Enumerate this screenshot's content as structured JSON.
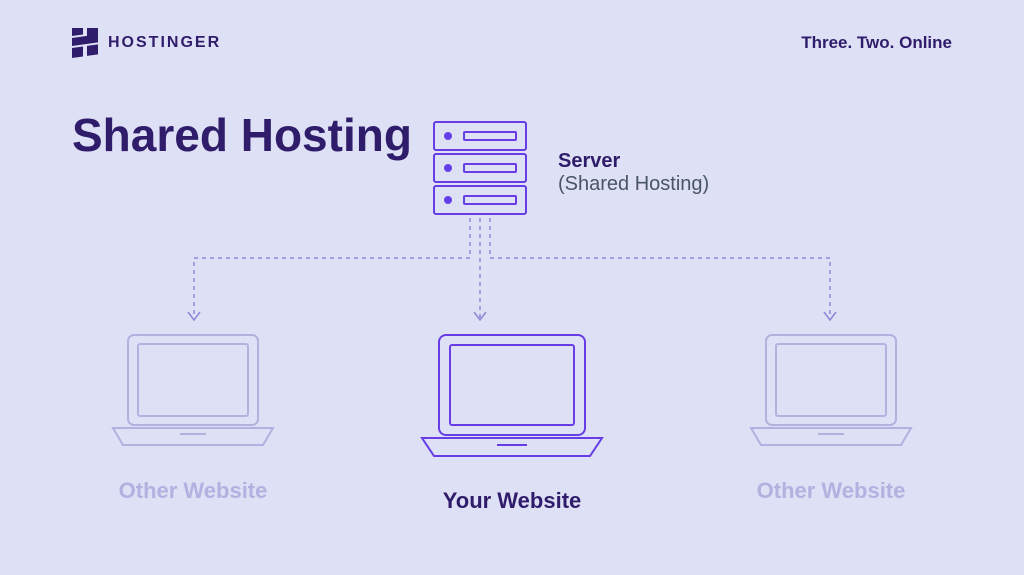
{
  "header": {
    "brand": "HOSTINGER",
    "tagline": "Three. Two. Online"
  },
  "title": "Shared Hosting",
  "server": {
    "label_title": "Server",
    "label_sub": "(Shared Hosting)"
  },
  "laptops": {
    "left": "Other Website",
    "center": "Your Website",
    "right": "Other Website"
  },
  "colors": {
    "accent": "#673de6",
    "light": "#b4b0e0",
    "dark": "#2f1c6a"
  }
}
